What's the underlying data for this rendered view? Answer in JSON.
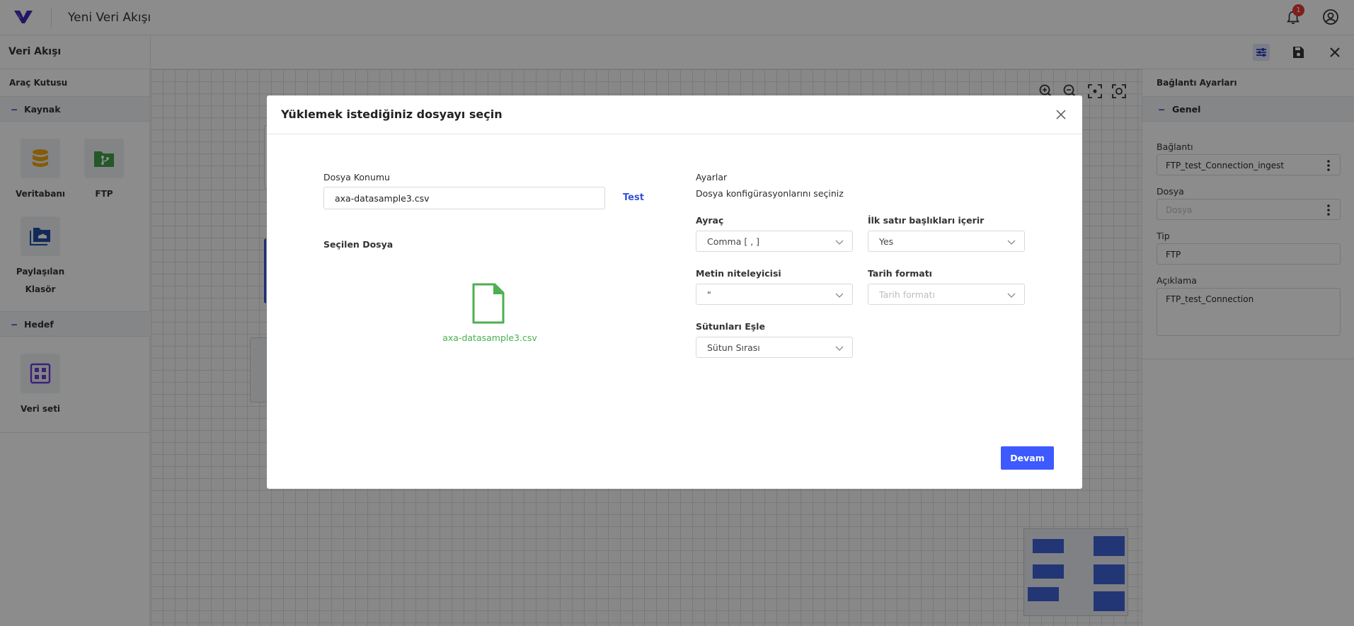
{
  "header": {
    "app_title": "Yeni Veri Akışı",
    "notification_count": "1"
  },
  "subheader": {
    "title": "Veri Akışı"
  },
  "toolbox": {
    "heading": "Araç Kutusu",
    "sections": [
      {
        "label": "Kaynak",
        "items": [
          {
            "label": "Veritabanı",
            "icon": "database-icon"
          },
          {
            "label": "FTP",
            "icon": "ftp-folder-icon"
          },
          {
            "label": "Paylaşılan Klasör",
            "icon": "shared-folder-icon"
          }
        ]
      },
      {
        "label": "Hedef",
        "items": [
          {
            "label": "Veri seti",
            "icon": "dataset-grid-icon"
          }
        ]
      }
    ]
  },
  "right_panel": {
    "heading": "Bağlantı Ayarları",
    "section": "Genel",
    "fields": {
      "baglanti_label": "Bağlantı",
      "baglanti_value": "FTP_test_Connection_ingest",
      "dosya_label": "Dosya",
      "dosya_placeholder": "Dosya",
      "tip_label": "Tip",
      "tip_value": "FTP",
      "aciklama_label": "Açıklama",
      "aciklama_value": "FTP_test_Connection"
    }
  },
  "modal": {
    "title": "Yüklemek istediğiniz dosyayı seçin",
    "file_location_label": "Dosya Konumu",
    "file_location_value": "axa-datasample3.csv",
    "test_label": "Test",
    "selected_file_label": "Seçilen Dosya",
    "selected_file_name": "axa-datasample3.csv",
    "settings_label": "Ayarlar",
    "settings_desc": "Dosya konfigürasyonlarını seçiniz",
    "delimiter_label": "Ayraç",
    "delimiter_value": "Comma [ , ]",
    "header_row_label": "İlk satır başlıkları içerir",
    "header_row_value": "Yes",
    "text_qualifier_label": "Metin niteleyicisi",
    "text_qualifier_value": "\"",
    "date_format_label": "Tarih formatı",
    "date_format_placeholder": "Tarih formatı",
    "column_map_label": "Sütunları Eşle",
    "column_map_value": "Sütun Sırası",
    "continue_label": "Devam"
  },
  "colors": {
    "accent": "#3d5afe",
    "file_green": "#4caf50",
    "link_blue": "#3553d8",
    "brand_purple": "#3b2bb5"
  }
}
